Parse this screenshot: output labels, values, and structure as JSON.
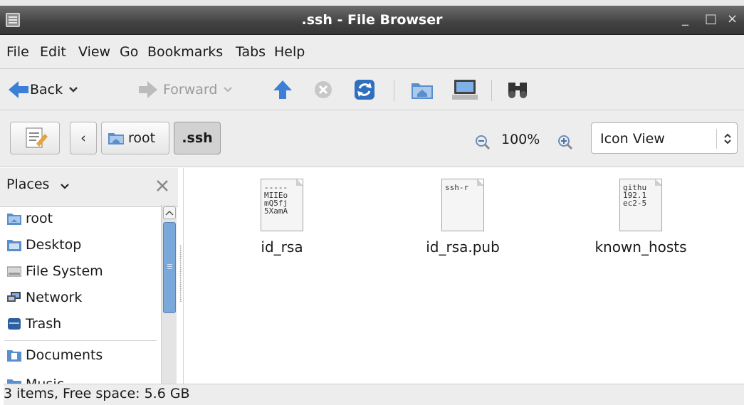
{
  "window": {
    "title": ".ssh - File Browser",
    "minimize": "_",
    "maximize": "□",
    "close": "×"
  },
  "menu": [
    "File",
    "Edit",
    "View",
    "Go",
    "Bookmarks",
    "Tabs",
    "Help"
  ],
  "toolbar": {
    "back_label": "Back",
    "forward_label": "Forward"
  },
  "location": {
    "path": [
      "root",
      ".ssh"
    ],
    "zoom": "100%",
    "view_mode": "Icon View"
  },
  "sidebar": {
    "header": "Places",
    "places": [
      "root",
      "Desktop",
      "File System",
      "Network",
      "Trash",
      "Documents",
      "Music"
    ]
  },
  "files": [
    {
      "name": "id_rsa",
      "preview": "-----\nMIIEo\nmQ5fj\n5XamA"
    },
    {
      "name": "id_rsa.pub",
      "preview": "ssh-r"
    },
    {
      "name": "known_hosts",
      "preview": "githu\n192.1\nec2-5"
    }
  ],
  "status": "3 items, Free space: 5.6 GB",
  "colors": {
    "folder": "#5a8fcc",
    "back_arrow": "#3d7fd6",
    "titlebar": "#424242"
  }
}
